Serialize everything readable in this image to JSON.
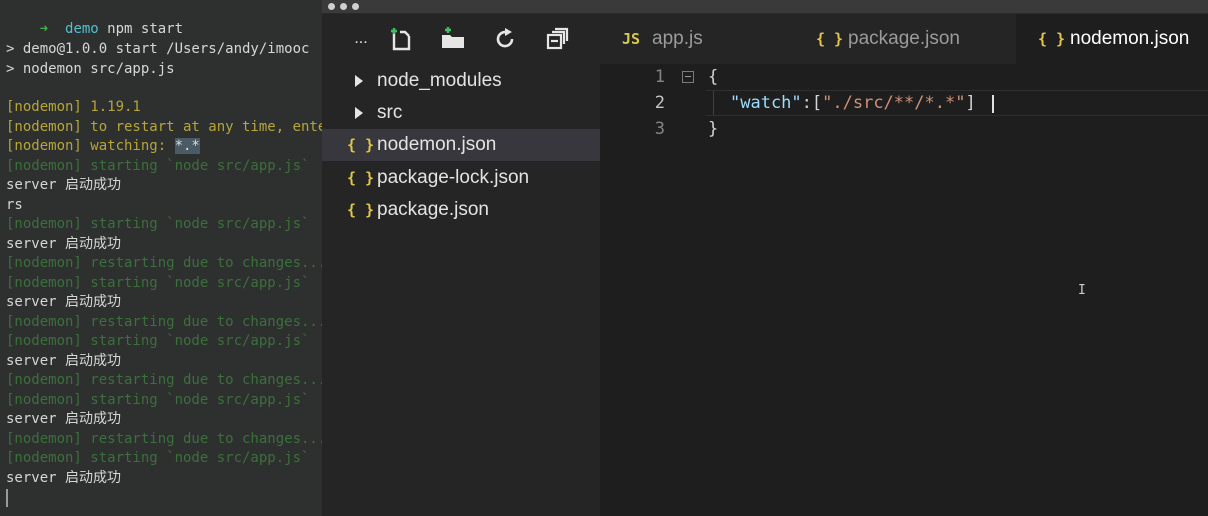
{
  "terminal": {
    "prompt_arrow": "➜",
    "prompt_dir": "demo",
    "prompt_cmd": "npm start",
    "lines": [
      "> demo@1.0.0 start /Users/andy/imooc",
      "> nodemon src/app.js",
      "[nodemon] 1.19.1",
      "[nodemon] to restart at any time, enter `rs`",
      "[nodemon] watching: ",
      "*.*",
      "[nodemon] starting `node src/app.js`",
      "server 启动成功",
      "rs",
      "[nodemon] restarting due to changes...",
      "server 启动成功"
    ]
  },
  "sidebar": {
    "toolbar": {
      "more_label": "...",
      "icons": [
        "new-file-icon",
        "new-folder-icon",
        "refresh-icon",
        "collapse-all-icon"
      ]
    },
    "items": [
      {
        "label": "node_modules",
        "type": "folder"
      },
      {
        "label": "src",
        "type": "folder"
      },
      {
        "label": "nodemon.json",
        "type": "json",
        "icon": "{ }"
      },
      {
        "label": "package-lock.json",
        "type": "json",
        "icon": "{ }"
      },
      {
        "label": "package.json",
        "type": "json",
        "icon": "{ }"
      }
    ]
  },
  "tabs": [
    {
      "label": "app.js",
      "icon": "JS"
    },
    {
      "label": "package.json",
      "icon": "{ }"
    },
    {
      "label": "nodemon.json",
      "icon": "{ }",
      "active": true
    }
  ],
  "editor": {
    "line_numbers": [
      "1",
      "2",
      "3"
    ],
    "line1": "{",
    "line2_key": "\"watch\"",
    "line2_punct": ":[",
    "line2_value": "\"./src/**/*.*\"",
    "line2_end": "]",
    "line3": "}",
    "ibeam": "I"
  },
  "colors": {
    "json_icon": "#e0c64a",
    "js_icon": "#d7c94e",
    "nodemon_yellow": "#b6a638",
    "nodemon_green": "#3b6f3b"
  }
}
